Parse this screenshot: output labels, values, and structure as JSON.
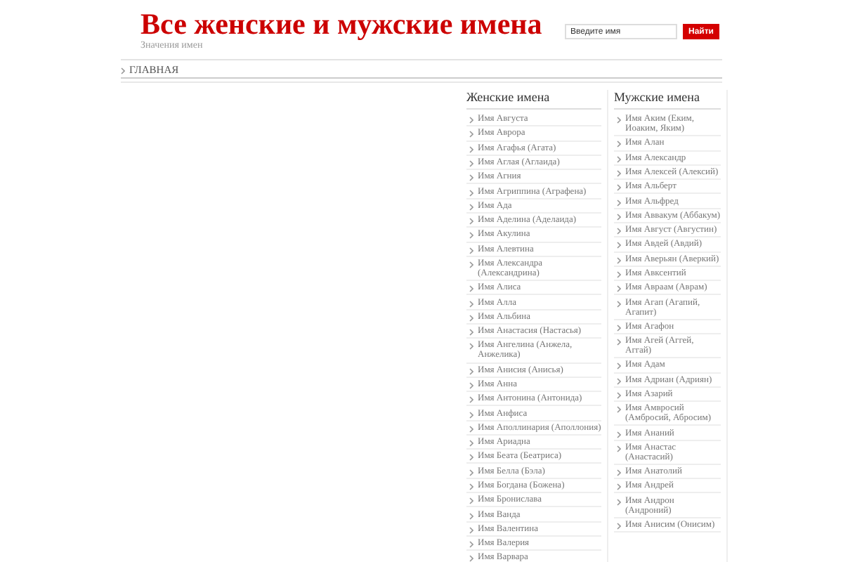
{
  "site": {
    "title": "Все женские и мужские имена",
    "tagline": "Значения имен"
  },
  "search": {
    "placeholder": "Введите имя",
    "button": "Найти"
  },
  "nav": [
    {
      "label": "ГЛАВНАЯ"
    }
  ],
  "sidebar": [
    {
      "heading": "Женские имена",
      "items": [
        "Имя Августа",
        "Имя Аврора",
        "Имя Агафья (Агата)",
        "Имя Аглая (Аглаида)",
        "Имя Агния",
        "Имя Агриппина (Аграфена)",
        "Имя Ада",
        "Имя Аделина (Аделаида)",
        "Имя Акулина",
        "Имя Алевтина",
        "Имя Александра (Александрина)",
        "Имя Алиса",
        "Имя Алла",
        "Имя Альбина",
        "Имя Анастасия (Настасья)",
        "Имя Ангелина (Анжела, Анжелика)",
        "Имя Анисия (Анисья)",
        "Имя Анна",
        "Имя Антонина (Антонида)",
        "Имя Анфиса",
        "Имя Аполлинария (Аполлония)",
        "Имя Ариадна",
        "Имя Беата (Беатриса)",
        "Имя Белла (Бэла)",
        "Имя Богдана (Божена)",
        "Имя Бронислава",
        "Имя Ванда",
        "Имя Валентина",
        "Имя Валерия",
        "Имя Варвара"
      ]
    },
    {
      "heading": "Мужские имена",
      "items": [
        "Имя Аким (Еким, Иоаким, Яким)",
        "Имя Алан",
        "Имя Александр",
        "Имя Алексей (Алексий)",
        "Имя Альберт",
        "Имя Альфред",
        "Имя Аввакум (Аббакум)",
        "Имя Август (Августин)",
        "Имя Авдей (Авдий)",
        "Имя Аверьян (Аверкий)",
        "Имя Авксентий",
        "Имя Авраам (Аврам)",
        "Имя Агап (Агапий, Агапит)",
        "Имя Агафон",
        "Имя Агей (Аггей, Аггай)",
        "Имя Адам",
        "Имя Адриан (Адриян)",
        "Имя Азарий",
        "Имя Амвросий (Амбросий, Абросим)",
        "Имя Ананий",
        "Имя Анастас (Анастасий)",
        "Имя Анатолий",
        "Имя Андрей",
        "Имя Андрон (Андроний)",
        "Имя Анисим (Онисим)"
      ]
    }
  ]
}
